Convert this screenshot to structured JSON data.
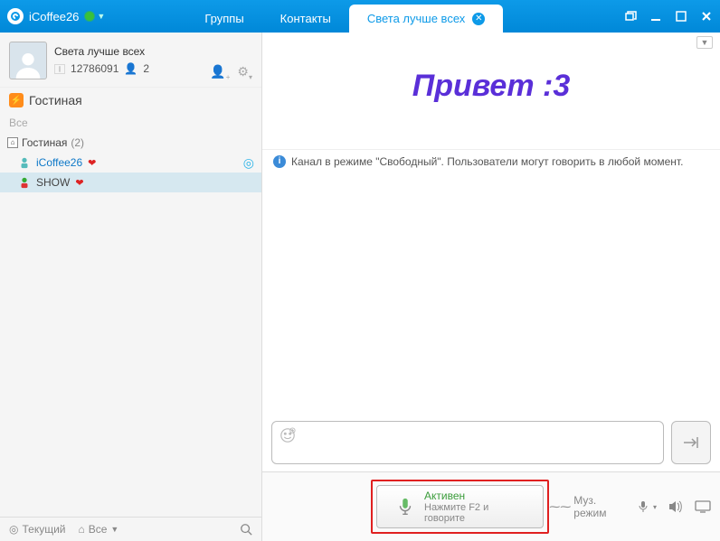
{
  "titlebar": {
    "appname": "iCoffee26",
    "tabs": {
      "groups": "Группы",
      "contacts": "Контакты",
      "active": "Света лучше всех"
    }
  },
  "sidebar": {
    "profile": {
      "name": "Света лучше всех",
      "id": "12786091",
      "people_count": "2"
    },
    "channel_name": "Гостиная",
    "all_label": "Все",
    "room": {
      "name": "Гостиная",
      "count": "(2)"
    },
    "users": [
      {
        "name": "iCoffee26"
      },
      {
        "name": "SHOW"
      }
    ],
    "bottom": {
      "current": "Текущий",
      "all": "Все"
    }
  },
  "content": {
    "banner": "Привет :3",
    "notice": "Канал в режиме \"Свободный\". Пользователи могут говорить в любой момент."
  },
  "bottom": {
    "mic_status": "Активен",
    "mic_hint": "Нажмите F2 и говорите",
    "music_mode": "Муз. режим"
  }
}
